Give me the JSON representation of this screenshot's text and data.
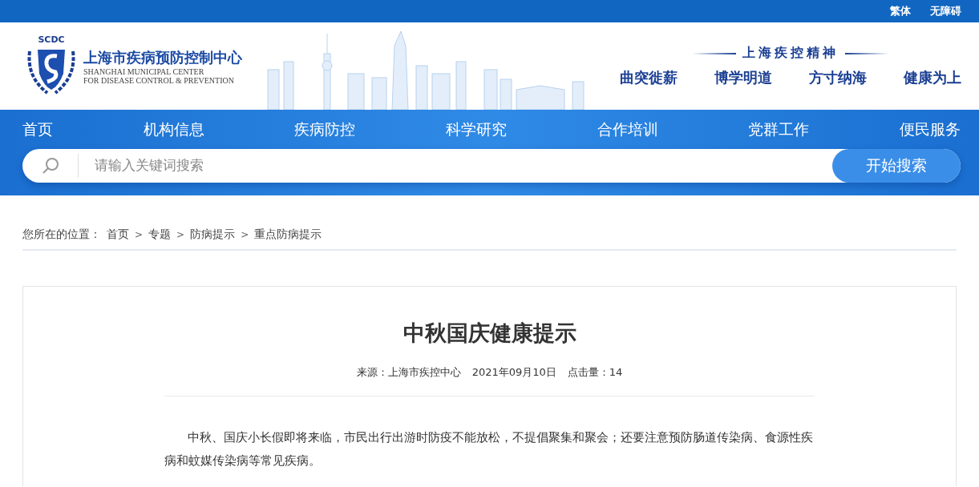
{
  "top_bar": {
    "links": [
      "繁体",
      "无障碍"
    ]
  },
  "header": {
    "logo": {
      "badge": "SCDC",
      "name_cn": "上海市疾病预防控制中心",
      "name_en_1": "SHANGHAI MUNICIPAL CENTER",
      "name_en_2": "FOR DISEASE CONTROL & PREVENTION"
    },
    "spirit": {
      "title": "上海疾控精神",
      "mottos": [
        "曲突徙薪",
        "博学明道",
        "方寸纳海",
        "健康为上"
      ]
    }
  },
  "nav": {
    "items": [
      "首页",
      "机构信息",
      "疾病防控",
      "科学研究",
      "合作培训",
      "党群工作",
      "便民服务"
    ]
  },
  "search": {
    "placeholder": "请输入关键词搜索",
    "button": "开始搜索"
  },
  "breadcrumb": {
    "label": "您所在的位置：",
    "parts": [
      {
        "kind": "link",
        "text": "首页"
      },
      {
        "kind": "sep",
        "text": ">"
      },
      {
        "kind": "link",
        "text": "专题"
      },
      {
        "kind": "sep",
        "text": ">"
      },
      {
        "kind": "link",
        "text": "防病提示"
      },
      {
        "kind": "sep",
        "text": ">"
      },
      {
        "kind": "link",
        "text": "重点防病提示"
      }
    ]
  },
  "article": {
    "title": "中秋国庆健康提示",
    "source": "来源：上海市疾控中心",
    "date": "2021年09月10日",
    "hits": "点击量：14",
    "paragraphs": [
      "中秋、国庆小长假即将来临，市民出行出游时防疫不能放松，不提倡聚集和聚会；还要注意预防肠道传染病、食源性疾病和蚊媒传染病等常见疾病。"
    ]
  }
}
